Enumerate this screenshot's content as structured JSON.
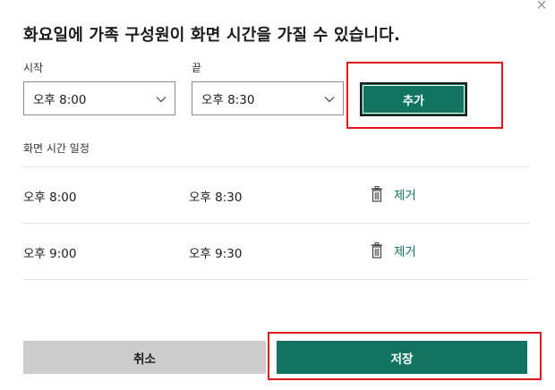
{
  "dialog": {
    "title": "화요일에 가족 구성원이 화면 시간을 가질 수 있습니다.",
    "close_label": "×"
  },
  "form": {
    "start_label": "시작",
    "end_label": "끝",
    "start_value": "오후 8:00",
    "end_value": "오후 8:30",
    "add_label": "추가"
  },
  "schedule": {
    "label": "화면 시간 일정",
    "rows": [
      {
        "start": "오후 8:00",
        "end": "오후 8:30",
        "remove_label": "제거"
      },
      {
        "start": "오후 9:00",
        "end": "오후 9:30",
        "remove_label": "제거"
      }
    ]
  },
  "footer": {
    "cancel_label": "취소",
    "save_label": "저장"
  },
  "colors": {
    "accent": "#107460",
    "highlight_box": "#e0161c",
    "cancel_bg": "#cccccc"
  },
  "icons": {
    "close": "close-icon",
    "dropdown": "chevron-down-icon",
    "remove": "trash-icon"
  }
}
